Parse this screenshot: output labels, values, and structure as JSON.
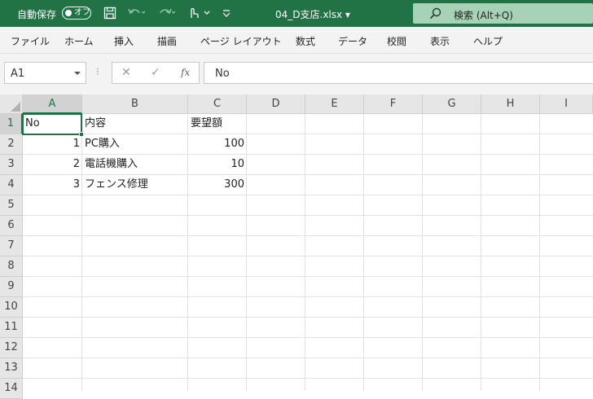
{
  "titlebar": {
    "autosave_label": "自動保存",
    "autosave_state": "オフ",
    "filename": "04_D支店.xlsx ▾",
    "search_placeholder": "検索 (Alt+Q)"
  },
  "menu": [
    {
      "label": "ファイル"
    },
    {
      "label": "ホーム"
    },
    {
      "label": "挿入"
    },
    {
      "label": "描画"
    },
    {
      "label": "ページ レイアウト"
    },
    {
      "label": "数式"
    },
    {
      "label": "データ"
    },
    {
      "label": "校閲"
    },
    {
      "label": "表示"
    },
    {
      "label": "ヘルプ"
    }
  ],
  "formula_bar": {
    "name_box": "A1",
    "formula": "No",
    "fx": "fx"
  },
  "grid": {
    "columns": [
      "A",
      "B",
      "C",
      "D",
      "E",
      "F",
      "G",
      "H",
      "I"
    ],
    "rows": [
      "1",
      "2",
      "3",
      "4",
      "5",
      "6",
      "7",
      "8",
      "9",
      "10",
      "11",
      "12",
      "13",
      "14"
    ],
    "cells": {
      "A1": "No",
      "B1": "内容",
      "C1": "要望額",
      "A2": "1",
      "B2": "PC購入",
      "C2": "100",
      "A3": "2",
      "B3": "電話機購入",
      "C3": "10",
      "A4": "3",
      "B4": "フェンス修理",
      "C4": "300"
    },
    "selected_cell": "A1"
  },
  "colors": {
    "accent": "#217346",
    "search_bg": "#a7d2b8"
  }
}
